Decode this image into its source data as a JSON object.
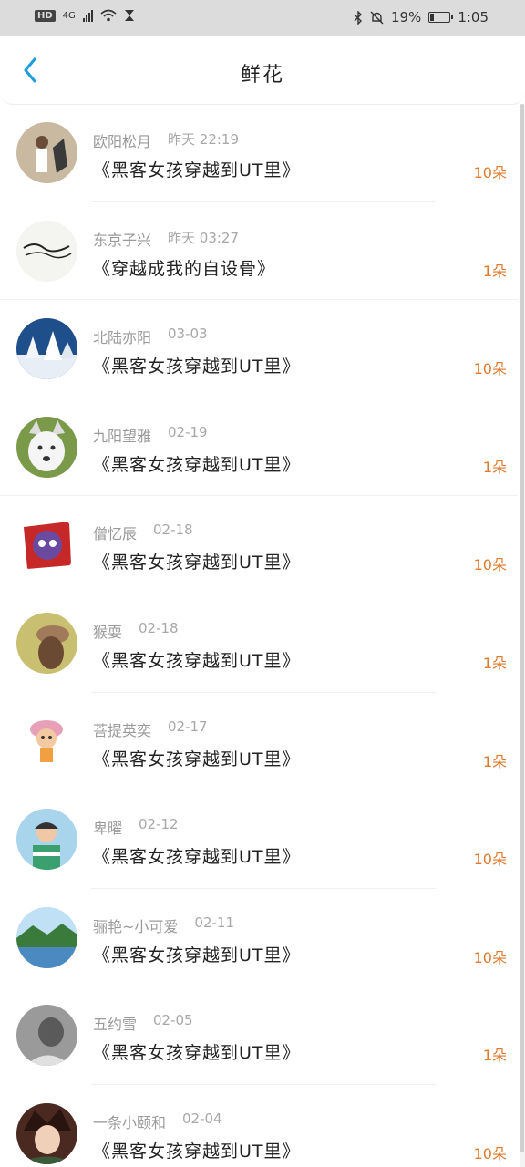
{
  "status_bar": {
    "hd": "HD",
    "network": "4G",
    "battery": "19%",
    "time": "1:05"
  },
  "header": {
    "title": "鲜花"
  },
  "colors": {
    "accent": "#1e9ce0",
    "count": "#e07a2e"
  },
  "records": [
    {
      "name": "欧阳松月",
      "time": "昨天 22:19",
      "book": "《黑客女孩穿越到UT里》",
      "count": "10朵"
    },
    {
      "name": "东京子兴",
      "time": "昨天 03:27",
      "book": "《穿越成我的自设骨》",
      "count": "1朵"
    },
    {
      "name": "北陆亦阳",
      "time": "03-03",
      "book": "《黑客女孩穿越到UT里》",
      "count": "10朵"
    },
    {
      "name": "九阳望雅",
      "time": "02-19",
      "book": "《黑客女孩穿越到UT里》",
      "count": "1朵"
    },
    {
      "name": "僧忆辰",
      "time": "02-18",
      "book": "《黑客女孩穿越到UT里》",
      "count": "10朵"
    },
    {
      "name": "猴耍",
      "time": "02-18",
      "book": "《黑客女孩穿越到UT里》",
      "count": "1朵"
    },
    {
      "name": "菩提英奕",
      "time": "02-17",
      "book": "《黑客女孩穿越到UT里》",
      "count": "1朵"
    },
    {
      "name": "卑曜",
      "time": "02-12",
      "book": "《黑客女孩穿越到UT里》",
      "count": "10朵"
    },
    {
      "name": "骊艳~小可爱",
      "time": "02-11",
      "book": "《黑客女孩穿越到UT里》",
      "count": "10朵"
    },
    {
      "name": "五约雪",
      "time": "02-05",
      "book": "《黑客女孩穿越到UT里》",
      "count": "1朵"
    },
    {
      "name": "一条小颐和",
      "time": "02-04",
      "book": "《黑客女孩穿越到UT里》",
      "count": "10朵"
    }
  ]
}
